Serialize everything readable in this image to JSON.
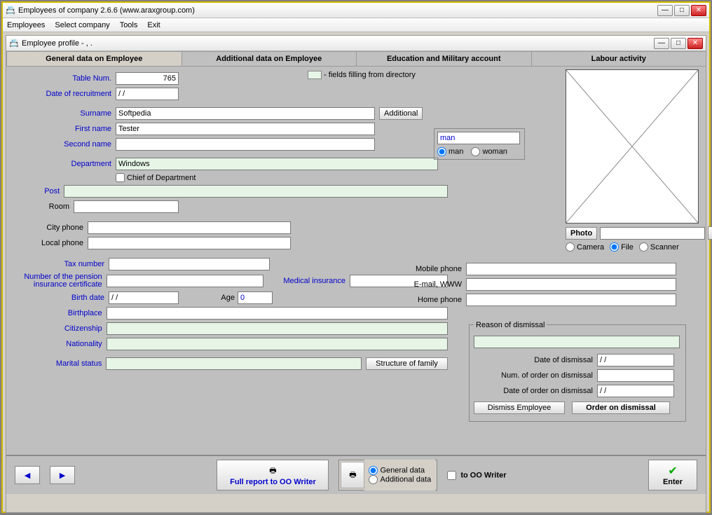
{
  "outer_window": {
    "title": "Employees of company 2.6.6 (www.araxgroup.com)"
  },
  "menu": [
    "Employees",
    "Select company",
    "Tools",
    "Exit"
  ],
  "inner_window": {
    "title": "Employee profile -  , ."
  },
  "tabs": [
    "General data on Employee",
    "Additional data on Employee",
    "Education and Military account",
    "Labour activity"
  ],
  "hint": "- fields filling from directory",
  "labels": {
    "table_num": "Table Num.",
    "date_recruit": "Date of recruitment",
    "surname": "Surname",
    "first_name": "First name",
    "second_name": "Second name",
    "department": "Department",
    "chief": "Chief of Department",
    "post": "Post",
    "room": "Room",
    "city_phone": "City phone",
    "local_phone": "Local phone",
    "mobile_phone": "Mobile phone",
    "email": "E-mail, WWW",
    "home_phone": "Home phone",
    "tax": "Tax number",
    "pension": "Number of the pension insurance certificate",
    "med_ins": "Medical insurance",
    "birth_date": "Birth date",
    "age": "Age",
    "birthplace": "Birthplace",
    "citizenship": "Citizenship",
    "nationality": "Nationality",
    "marital": "Marital status",
    "additional_btn": "Additional",
    "man": "man",
    "woman": "woman",
    "photo_btn": "Photo",
    "camera": "Camera",
    "file": "File",
    "scanner": "Scanner",
    "dismissal_legend": "Reason of dismissal",
    "date_dismissal": "Date of dismissal",
    "num_order_dismissal": "Num. of order on dismissal",
    "date_order_dismissal": "Date of order on dismissal",
    "dismiss_btn": "Dismiss Employee",
    "order_dismissal_btn": "Order on dismissal",
    "struct_family": "Structure of family"
  },
  "values": {
    "table_num": "765",
    "date_recruit": "/ /",
    "surname": "Softpedia",
    "first_name": "Tester",
    "second_name": "",
    "department": "Windows",
    "post": "",
    "room": "",
    "gender_text": "man",
    "age": "0",
    "birth_date": "/ /",
    "date_dismissal": "/ /",
    "date_order_dismissal": "/ /"
  },
  "bottom": {
    "full_report": "Full report to OO Writer",
    "general_data": "General data",
    "additional_data": "Additional data",
    "to_oo": "to OO Writer",
    "enter": "Enter"
  }
}
